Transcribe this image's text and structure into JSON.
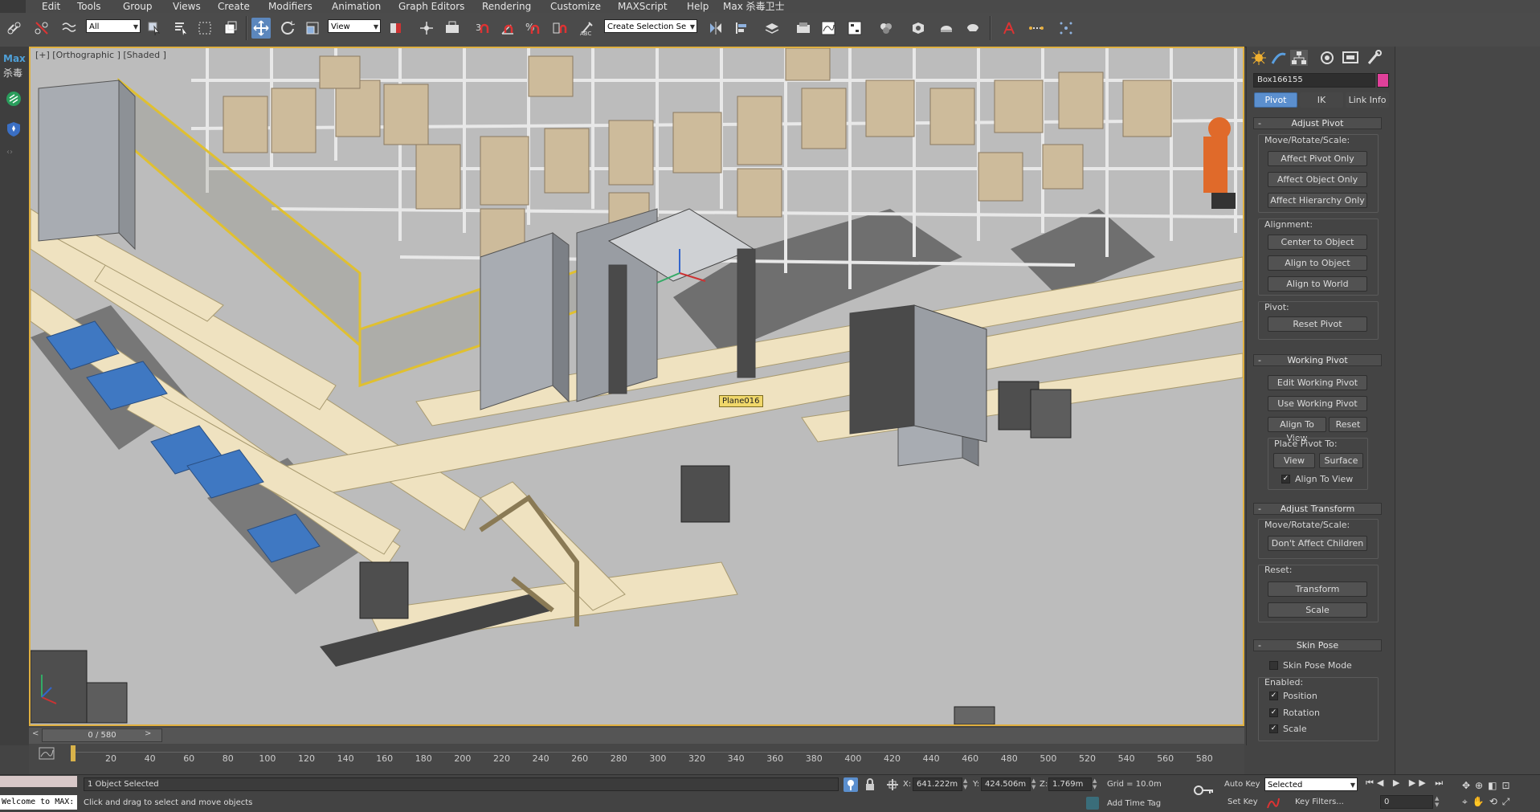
{
  "menu": {
    "items": [
      "Edit",
      "Tools",
      "Group",
      "Views",
      "Create",
      "Modifiers",
      "Animation",
      "Graph Editors",
      "Rendering",
      "Customize",
      "MAXScript",
      "Help",
      "Max 杀毒卫士"
    ]
  },
  "toolbar": {
    "filter_value": "All",
    "ref_coord_value": "View",
    "selection_set_value": "Create Selection Se"
  },
  "left_strip": {
    "max_label": "Max",
    "antivirus_label": "杀毒"
  },
  "viewport": {
    "label": "[+] [Orthographic ] [Shaded ]",
    "object_tag": "Plane016"
  },
  "command_panel": {
    "object_name": "Box166155",
    "object_color": "#e0409a",
    "tabs": [
      "Pivot",
      "IK",
      "Link Info"
    ],
    "adjust_pivot": {
      "title": "Adjust Pivot",
      "move_rotate_scale_label": "Move/Rotate/Scale:",
      "affect_pivot_only": "Affect Pivot Only",
      "affect_object_only": "Affect Object Only",
      "affect_hierarchy_only": "Affect Hierarchy Only",
      "alignment_label": "Alignment:",
      "center_to_object": "Center to Object",
      "align_to_object": "Align to Object",
      "align_to_world": "Align to World",
      "pivot_label": "Pivot:",
      "reset_pivot": "Reset Pivot"
    },
    "working_pivot": {
      "title": "Working Pivot",
      "edit_working_pivot": "Edit Working Pivot",
      "use_working_pivot": "Use Working Pivot",
      "align_to_view": "Align To View",
      "reset": "Reset",
      "place_pivot_to_label": "Place Pivot To:",
      "view": "View",
      "surface": "Surface",
      "align_to_view_check": "Align To View"
    },
    "adjust_transform": {
      "title": "Adjust Transform",
      "move_rotate_scale_label": "Move/Rotate/Scale:",
      "dont_affect_children": "Don't Affect Children",
      "reset_label": "Reset:",
      "transform": "Transform",
      "scale": "Scale"
    },
    "skin_pose": {
      "title": "Skin Pose",
      "skin_pose_mode": "Skin Pose Mode",
      "enabled_label": "Enabled:",
      "position": "Position",
      "rotation": "Rotation",
      "scale": "Scale"
    }
  },
  "timeline": {
    "frame_label": "0 / 580",
    "ticks": [
      "20",
      "40",
      "60",
      "80",
      "100",
      "120",
      "140",
      "160",
      "180",
      "200",
      "220",
      "240",
      "260",
      "280",
      "300",
      "320",
      "340",
      "360",
      "380",
      "400",
      "420",
      "440",
      "460",
      "480",
      "500",
      "520",
      "540",
      "560",
      "580"
    ]
  },
  "status": {
    "welcome": "Welcome to MAX:",
    "selection": "1 Object Selected",
    "prompt": "Click and drag to select and move objects",
    "x_label": "X:",
    "x_value": "641.222m",
    "y_label": "Y:",
    "y_value": "424.506m",
    "z_label": "Z:",
    "z_value": "1.769m",
    "grid": "Grid = 10.0m",
    "add_time_tag": "Add Time Tag",
    "auto_key": "Auto Key",
    "set_key": "Set Key",
    "selected_value": "Selected",
    "key_filters": "Key Filters...",
    "frame_value": "0"
  }
}
